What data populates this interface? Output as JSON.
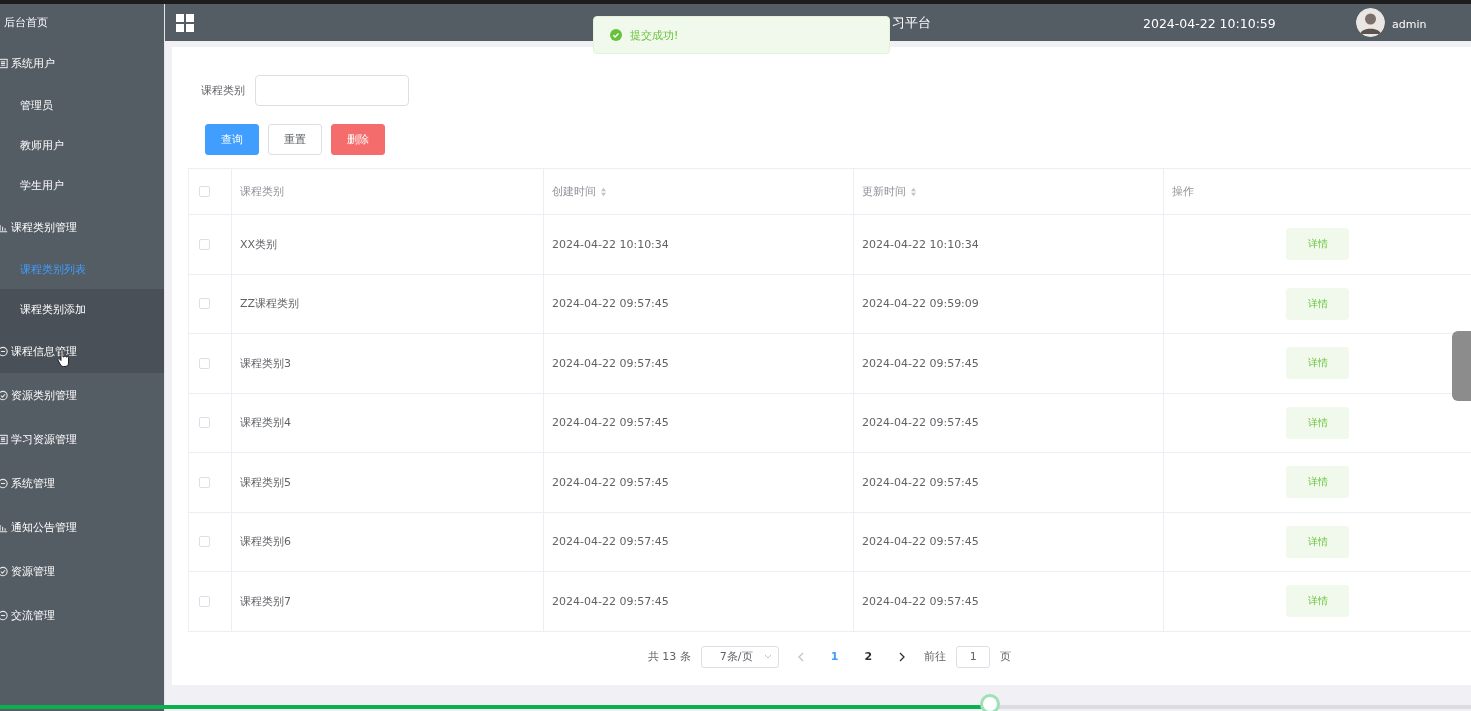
{
  "sidebar": {
    "home": "后台首页",
    "groups": [
      {
        "label": "系统用户",
        "highlighted": false,
        "children": [
          {
            "label": "管理员",
            "selected": false,
            "highlighted": false
          },
          {
            "label": "教师用户",
            "selected": false,
            "highlighted": false
          },
          {
            "label": "学生用户",
            "selected": false,
            "highlighted": false
          }
        ]
      },
      {
        "label": "课程类别管理",
        "highlighted": false,
        "children": [
          {
            "label": "课程类别列表",
            "selected": true,
            "highlighted": false
          },
          {
            "label": "课程类别添加",
            "selected": false,
            "highlighted": true
          }
        ]
      },
      {
        "label": "课程信息管理",
        "highlighted": true
      },
      {
        "label": "资源类别管理",
        "highlighted": false
      },
      {
        "label": "学习资源管理",
        "highlighted": false
      },
      {
        "label": "系统管理",
        "highlighted": false
      },
      {
        "label": "通知公告管理",
        "highlighted": false
      },
      {
        "label": "资源管理",
        "highlighted": false
      },
      {
        "label": "交流管理",
        "highlighted": false
      }
    ]
  },
  "header": {
    "title": "习平台",
    "datetime": "2024-04-22 10:10:59",
    "user": "admin"
  },
  "toast": {
    "message": "提交成功!"
  },
  "filter": {
    "label": "课程类别",
    "buttons": [
      {
        "label": "查询",
        "kind": "primary"
      },
      {
        "label": "重置",
        "kind": "default"
      },
      {
        "label": "删除",
        "kind": "danger"
      }
    ]
  },
  "table": {
    "all_checked": false,
    "columns": [
      {
        "label": "课程类别",
        "kind": "plain"
      },
      {
        "label": "创建时间",
        "kind": "sortable"
      },
      {
        "label": "更新时间",
        "kind": "sortable"
      },
      {
        "label": "操作",
        "kind": "plain"
      }
    ],
    "rows": [
      {
        "checked": false,
        "name": "XX类别",
        "created": "2024-04-22 10:10:34",
        "updated": "2024-04-22 10:10:34",
        "action": "详情"
      },
      {
        "checked": false,
        "name": "ZZ课程类别",
        "created": "2024-04-22 09:57:45",
        "updated": "2024-04-22 09:59:09",
        "action": "详情"
      },
      {
        "checked": false,
        "name": "课程类别3",
        "created": "2024-04-22 09:57:45",
        "updated": "2024-04-22 09:57:45",
        "action": "详情"
      },
      {
        "checked": false,
        "name": "课程类别4",
        "created": "2024-04-22 09:57:45",
        "updated": "2024-04-22 09:57:45",
        "action": "详情"
      },
      {
        "checked": false,
        "name": "课程类别5",
        "created": "2024-04-22 09:57:45",
        "updated": "2024-04-22 09:57:45",
        "action": "详情"
      },
      {
        "checked": false,
        "name": "课程类别6",
        "created": "2024-04-22 09:57:45",
        "updated": "2024-04-22 09:57:45",
        "action": "详情"
      },
      {
        "checked": false,
        "name": "课程类别7",
        "created": "2024-04-22 09:57:45",
        "updated": "2024-04-22 09:57:45",
        "action": "详情"
      }
    ]
  },
  "pagination": {
    "total": "共 13 条",
    "page_size": "7条/页",
    "pages": [
      {
        "label": "1",
        "selected": true
      },
      {
        "label": "2",
        "selected": false
      }
    ],
    "goto_label": "前往",
    "goto_value": "1",
    "goto_suffix": "页"
  },
  "player": {
    "level": 0.673
  }
}
